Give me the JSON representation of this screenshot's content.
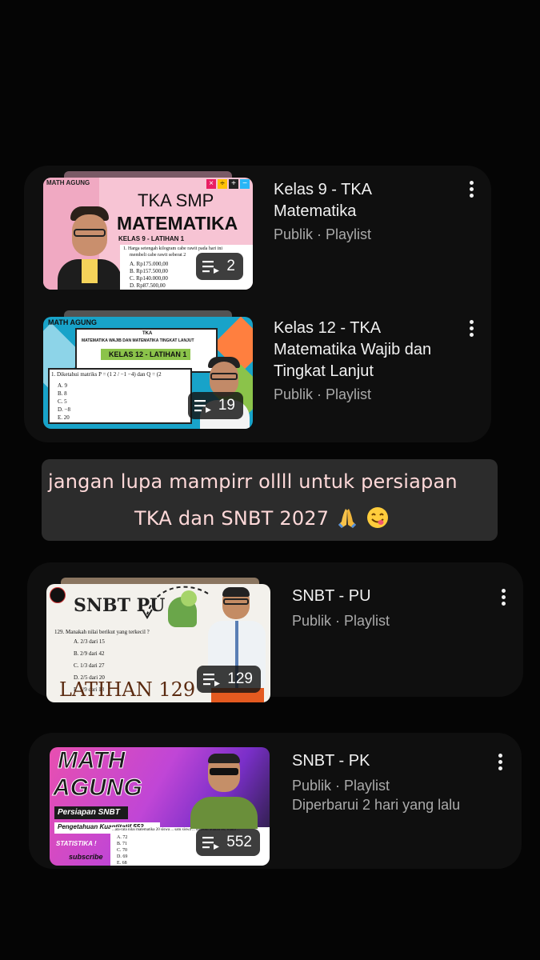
{
  "playlists_group_1": [
    {
      "title_lines": [
        "Kelas 9 - TKA",
        "Matematika"
      ],
      "meta": "Publik · Playlist",
      "count": "2",
      "thumb": {
        "brand": "MATH AGUNG",
        "headline1": "TKA SMP",
        "headline2": "MATEMATIKA",
        "subtitle": "KELAS 9 - LATIHAN 1",
        "question": "1.  Harga setengah kilogram cabe rawit pada hari ini",
        "question2": "membeli cabe rawit seberat 2",
        "options": [
          "A.  Rp175.000,00",
          "B.  Rp157.500,00",
          "C.  Rp140.000,00",
          "D.  Rp87.500,00"
        ],
        "ops": [
          "×",
          "÷",
          "+",
          "−"
        ]
      }
    },
    {
      "title_lines": [
        "Kelas 12 - TKA",
        "Matematika Wajib dan",
        "Tingkat Lanjut"
      ],
      "meta": "Publik · Playlist",
      "count": "19",
      "thumb": {
        "brand": "MATH AGUNG",
        "header1": "TKA",
        "header2": "MATEMATIKA WAJIB DAN MATEMATIKA TINGKAT LANJUT",
        "banner": "KELAS 12 - LATIHAN 1",
        "question": "1.  Diketahui matriks P = (1  2 / −1  −4) dan Q = (2",
        "options": [
          "A.  9",
          "B.  8",
          "C.  5",
          "D.  −8",
          "E.  20"
        ]
      }
    }
  ],
  "caption": {
    "line1": "jangan lupa mampirr ollll untuk persiapan",
    "line2": "TKA dan SNBT 2027",
    "emoji": [
      "folded-hands-emoji",
      "yum-face-emoji"
    ]
  },
  "playlist_snbt_pu": {
    "title": "SNBT - PU",
    "meta": "Publik · Playlist",
    "count": "129",
    "thumb": {
      "headline": "SNBT PU",
      "question": "129.  Manakah nilai berikut yang terkecil ?",
      "options": [
        "A.  2/3 dari 15",
        "B.  2/9 dari 42",
        "C.  1/3 dari 27",
        "D.  2/5 dari 20",
        "E.  5/9 dari 18"
      ],
      "footer": "LATIHAN 129"
    }
  },
  "playlist_snbt_pk": {
    "title": "SNBT - PK",
    "meta": "Publik · Playlist",
    "updated": "Diperbarui 2 hari yang lalu",
    "count": "552",
    "thumb": {
      "brand1": "MATH",
      "brand2": "AGUNG",
      "tag1": "Persiapan SNBT",
      "tag2": "Pengetahuan Kuantitatif 552",
      "tag3": "STATISTIKA !",
      "tag4": "subscribe",
      "question": "...ata-rata nilai matematika 20 siswa ... satu siswa ... tersebut adalah 80, maka ...",
      "options": [
        "A.  72",
        "B.  71",
        "C.  70",
        "D.  69",
        "E.  68"
      ]
    }
  },
  "colors": {
    "background": "#050505",
    "card": "#0f0f0f",
    "title": "#f1f1f1",
    "meta": "#aaaaaa",
    "caption_bg": "#2c2c2c",
    "caption_text": "#ffd9d9"
  }
}
